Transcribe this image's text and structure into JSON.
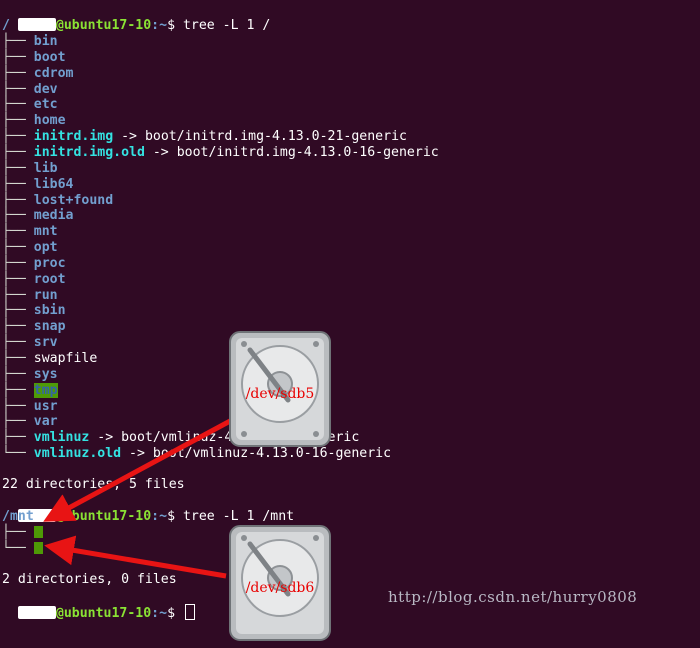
{
  "prompt": {
    "host": "@ubuntu17-10",
    "path": ":~",
    "symbol": "$"
  },
  "cmd1": "tree -L 1 /",
  "root_label": "/",
  "tree": [
    {
      "name": "bin",
      "kind": "dir"
    },
    {
      "name": "boot",
      "kind": "dir"
    },
    {
      "name": "cdrom",
      "kind": "dir"
    },
    {
      "name": "dev",
      "kind": "dir"
    },
    {
      "name": "etc",
      "kind": "dir"
    },
    {
      "name": "home",
      "kind": "dir"
    },
    {
      "name": "initrd.img",
      "kind": "link",
      "target": "boot/initrd.img-4.13.0-21-generic"
    },
    {
      "name": "initrd.img.old",
      "kind": "link",
      "target": "boot/initrd.img-4.13.0-16-generic"
    },
    {
      "name": "lib",
      "kind": "dir"
    },
    {
      "name": "lib64",
      "kind": "dir"
    },
    {
      "name": "lost+found",
      "kind": "dir"
    },
    {
      "name": "media",
      "kind": "dir"
    },
    {
      "name": "mnt",
      "kind": "dir"
    },
    {
      "name": "opt",
      "kind": "dir"
    },
    {
      "name": "proc",
      "kind": "dir"
    },
    {
      "name": "root",
      "kind": "dir"
    },
    {
      "name": "run",
      "kind": "dir"
    },
    {
      "name": "sbin",
      "kind": "dir"
    },
    {
      "name": "snap",
      "kind": "dir"
    },
    {
      "name": "srv",
      "kind": "dir"
    },
    {
      "name": "swapfile",
      "kind": "file"
    },
    {
      "name": "sys",
      "kind": "dir"
    },
    {
      "name": "tmp",
      "kind": "sticky"
    },
    {
      "name": "usr",
      "kind": "dir"
    },
    {
      "name": "var",
      "kind": "dir"
    },
    {
      "name": "vmlinuz",
      "kind": "link",
      "target": "boot/vmlinuz-4.13.0-21-generic"
    },
    {
      "name": "vmlinuz.old",
      "kind": "link",
      "target": "boot/vmlinuz-4.13.0-16-generic"
    }
  ],
  "tree_glyphs": {
    "branch": "├── ",
    "last": "└── ",
    "link_arrow": " -> "
  },
  "summary1": "22 directories, 5 files",
  "cmd2": "tree -L 1 /mnt",
  "mnt_label": "/mnt",
  "mnt_glyphs": {
    "branch": "├── ",
    "last": "└── "
  },
  "summary2": "2 directories, 0 files",
  "annotations": {
    "drive1_label": "/dev/sdb5",
    "drive2_label": "/dev/sdb6",
    "arrow_color": "#e81414",
    "drive_icon": "hard-drive-icon"
  },
  "watermark": "http://blog.csdn.net/hurry0808",
  "colors": {
    "background": "#300a24",
    "prompt_user": "#8ae234",
    "prompt_path": "#729fcf",
    "directory": "#729fcf",
    "symlink": "#34e2e2",
    "sticky_bg": "#4e9a06"
  }
}
